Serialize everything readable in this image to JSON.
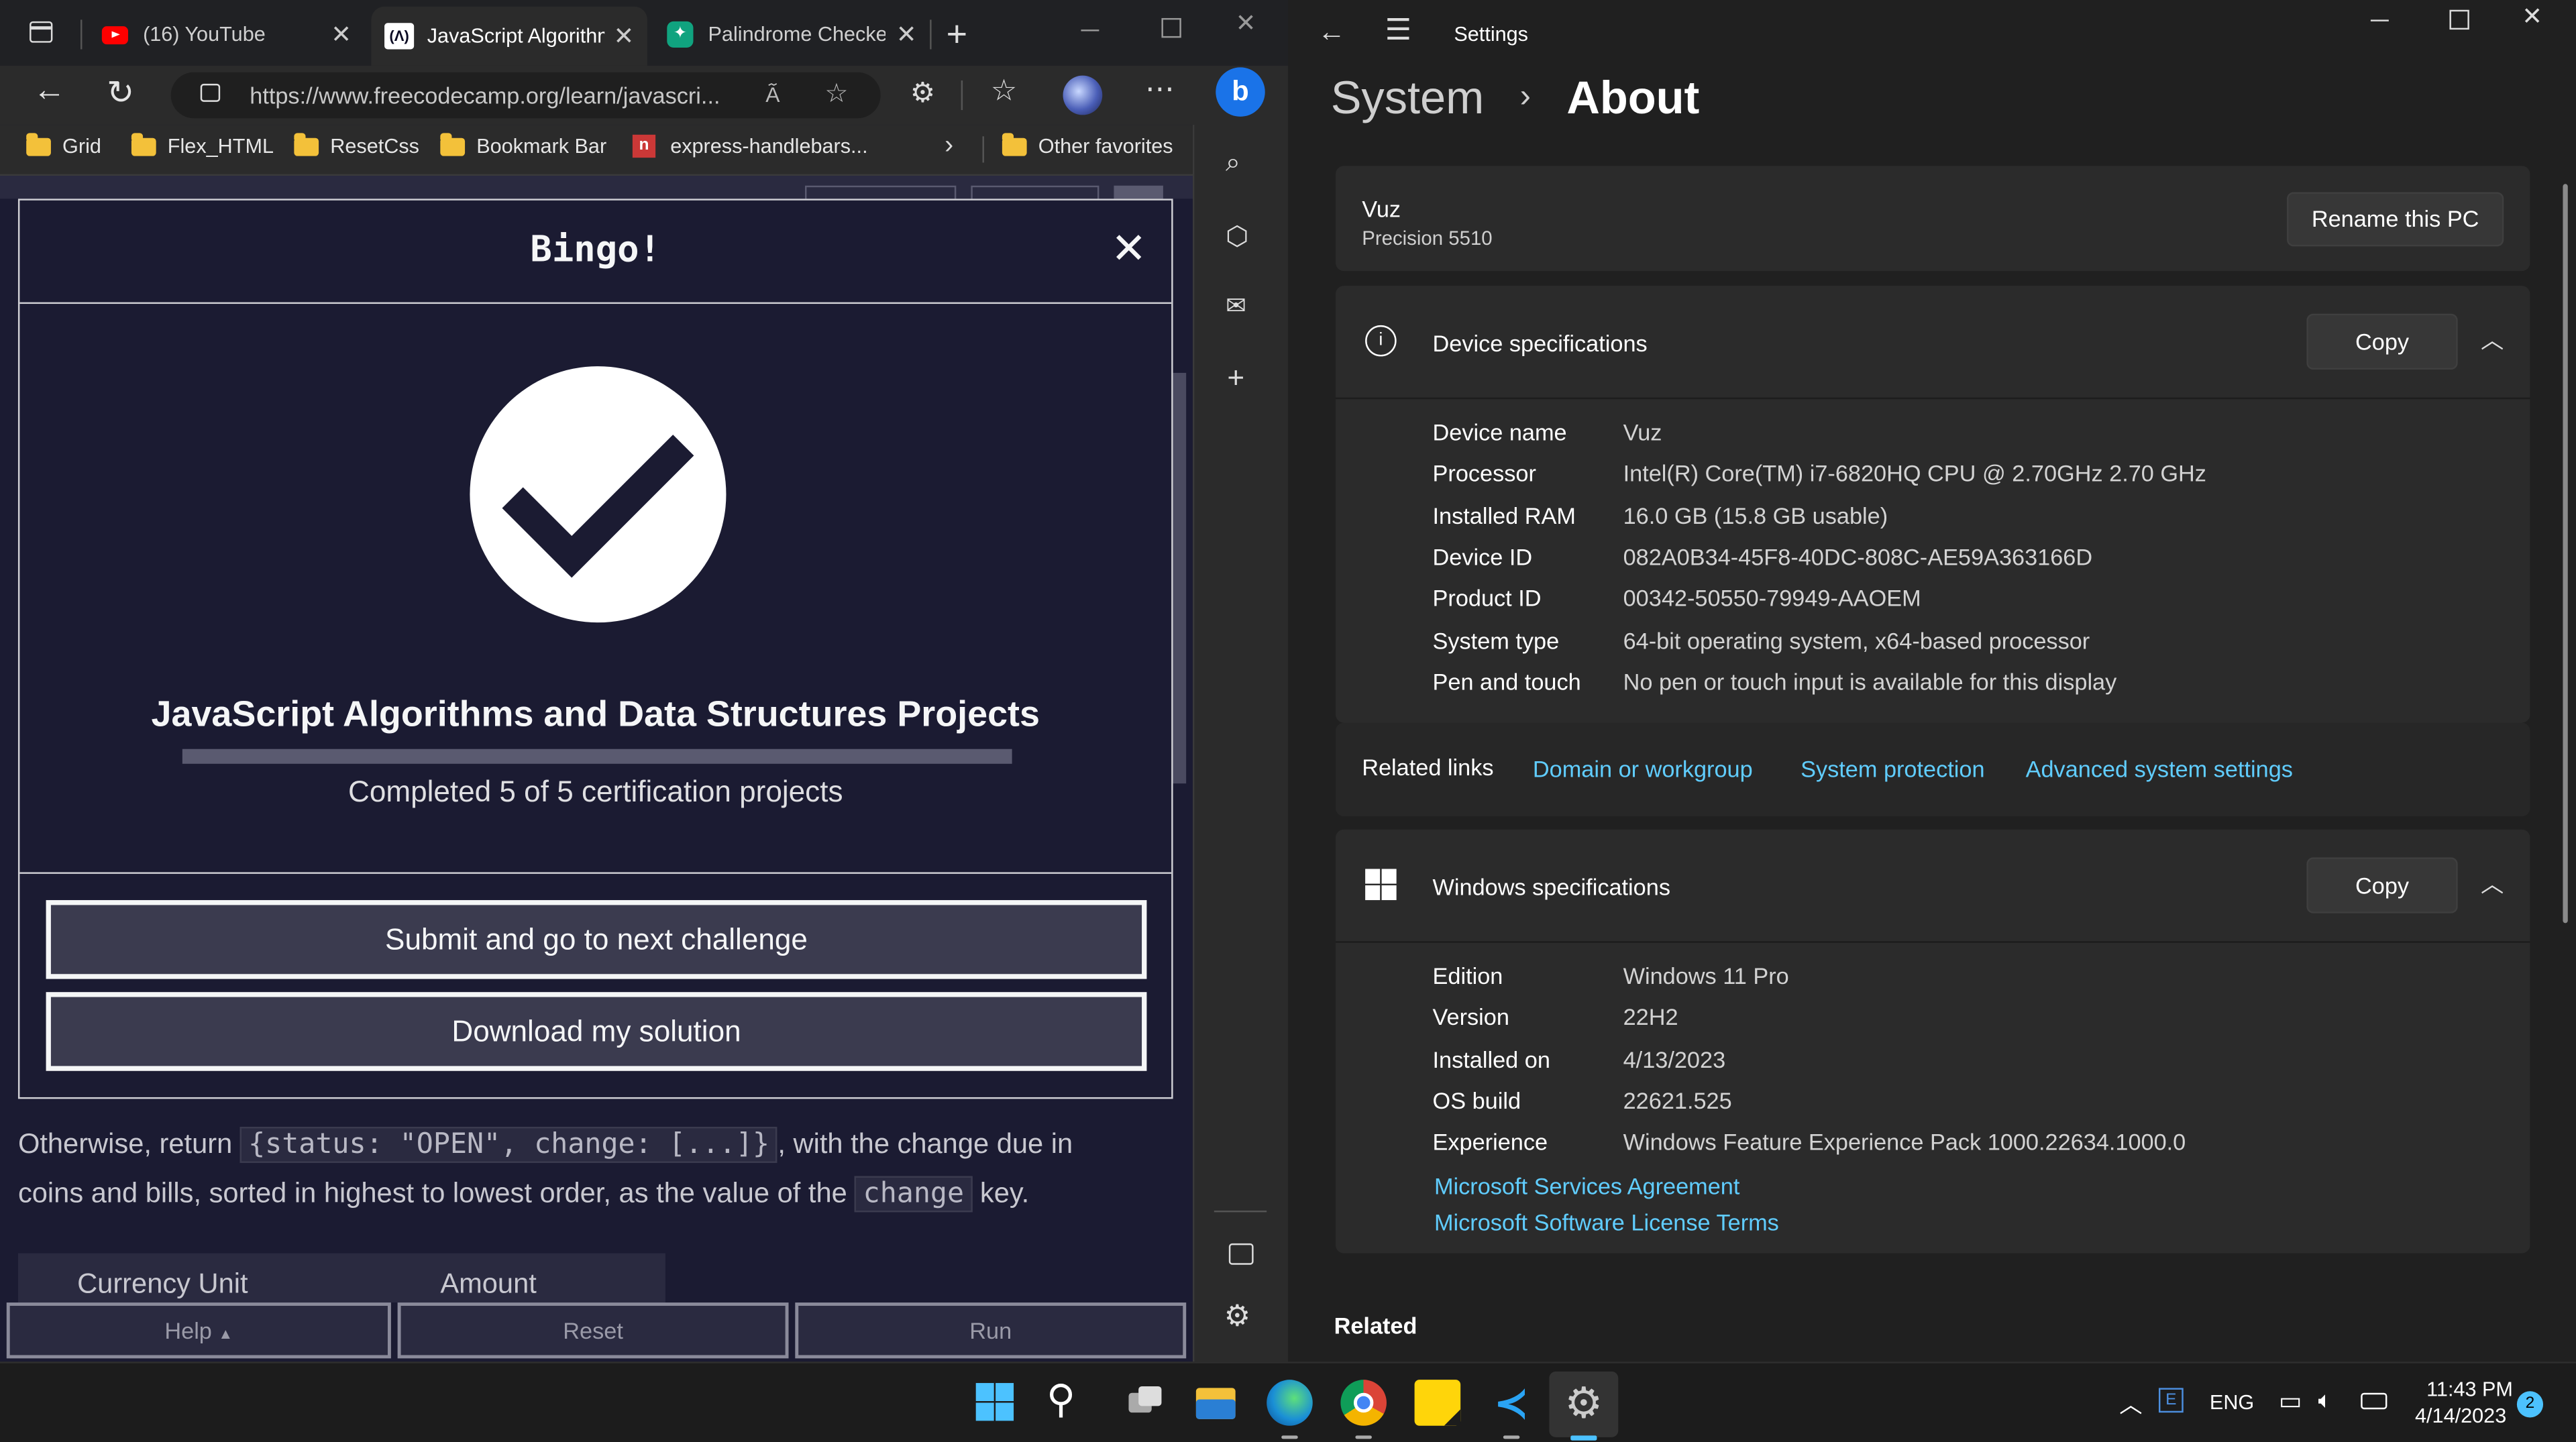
{
  "browser": {
    "tabs": [
      {
        "title": "(16) YouTube"
      },
      {
        "title": "JavaScript Algorithms"
      },
      {
        "title": "Palindrome Checker"
      }
    ],
    "url": "https://www.freecodecamp.org/learn/javascri...",
    "favorites": [
      "Grid",
      "Flex_HTML",
      "ResetCss",
      "Bookmark Bar",
      "express-handlebars...",
      "Other favorites"
    ]
  },
  "modal": {
    "title": "Bingo!",
    "cert_title": "JavaScript Algorithms and Data Structures Projects",
    "progress": 1.0,
    "progress_text": "Completed 5 of 5 certification projects",
    "submit_label": "Submit and go to next challenge",
    "download_label": "Download my solution"
  },
  "page": {
    "text_a": "Otherwise, return",
    "code_a": "{status: \"OPEN\", change: [...]}",
    "text_b": ", with the change due in",
    "text_c": "coins and bills, sorted in highest to lowest order, as the value of the",
    "code_b": "change",
    "text_d": "key.",
    "table_headers": [
      "Currency Unit",
      "Amount"
    ],
    "help_label": "Help",
    "reset_label": "Reset",
    "run_label": "Run"
  },
  "settings": {
    "header": "Settings",
    "breadcrumb_parent": "System",
    "breadcrumb_current": "About",
    "pc_name": "Vuz",
    "pc_model": "Precision 5510",
    "rename_label": "Rename this PC",
    "device_specs": {
      "title": "Device specifications",
      "copy_label": "Copy",
      "rows": [
        {
          "label": "Device name",
          "value": "Vuz"
        },
        {
          "label": "Processor",
          "value": "Intel(R) Core(TM) i7-6820HQ CPU @ 2.70GHz   2.70 GHz"
        },
        {
          "label": "Installed RAM",
          "value": "16.0 GB (15.8 GB usable)"
        },
        {
          "label": "Device ID",
          "value": "082A0B34-45F8-40DC-808C-AE59A363166D"
        },
        {
          "label": "Product ID",
          "value": "00342-50550-79949-AAOEM"
        },
        {
          "label": "System type",
          "value": "64-bit operating system, x64-based processor"
        },
        {
          "label": "Pen and touch",
          "value": "No pen or touch input is available for this display"
        }
      ]
    },
    "related_links": {
      "label": "Related links",
      "links": [
        "Domain or workgroup",
        "System protection",
        "Advanced system settings"
      ]
    },
    "windows_specs": {
      "title": "Windows specifications",
      "copy_label": "Copy",
      "rows": [
        {
          "label": "Edition",
          "value": "Windows 11 Pro"
        },
        {
          "label": "Version",
          "value": "22H2"
        },
        {
          "label": "Installed on",
          "value": "4/13/2023"
        },
        {
          "label": "OS build",
          "value": "22621.525"
        },
        {
          "label": "Experience",
          "value": "Windows Feature Experience Pack 1000.22634.1000.0"
        }
      ],
      "links": [
        "Microsoft Services Agreement",
        "Microsoft Software License Terms"
      ]
    },
    "related_heading": "Related"
  },
  "taskbar": {
    "language": "ENG",
    "time": "11:43 PM",
    "date": "4/14/2023",
    "notification_count": "2"
  },
  "colors": {
    "fcc_bg": "#1b1b32",
    "fcc_button": "#3b3b4f",
    "win_link": "#60cdff",
    "win_card": "#2b2b2b"
  }
}
